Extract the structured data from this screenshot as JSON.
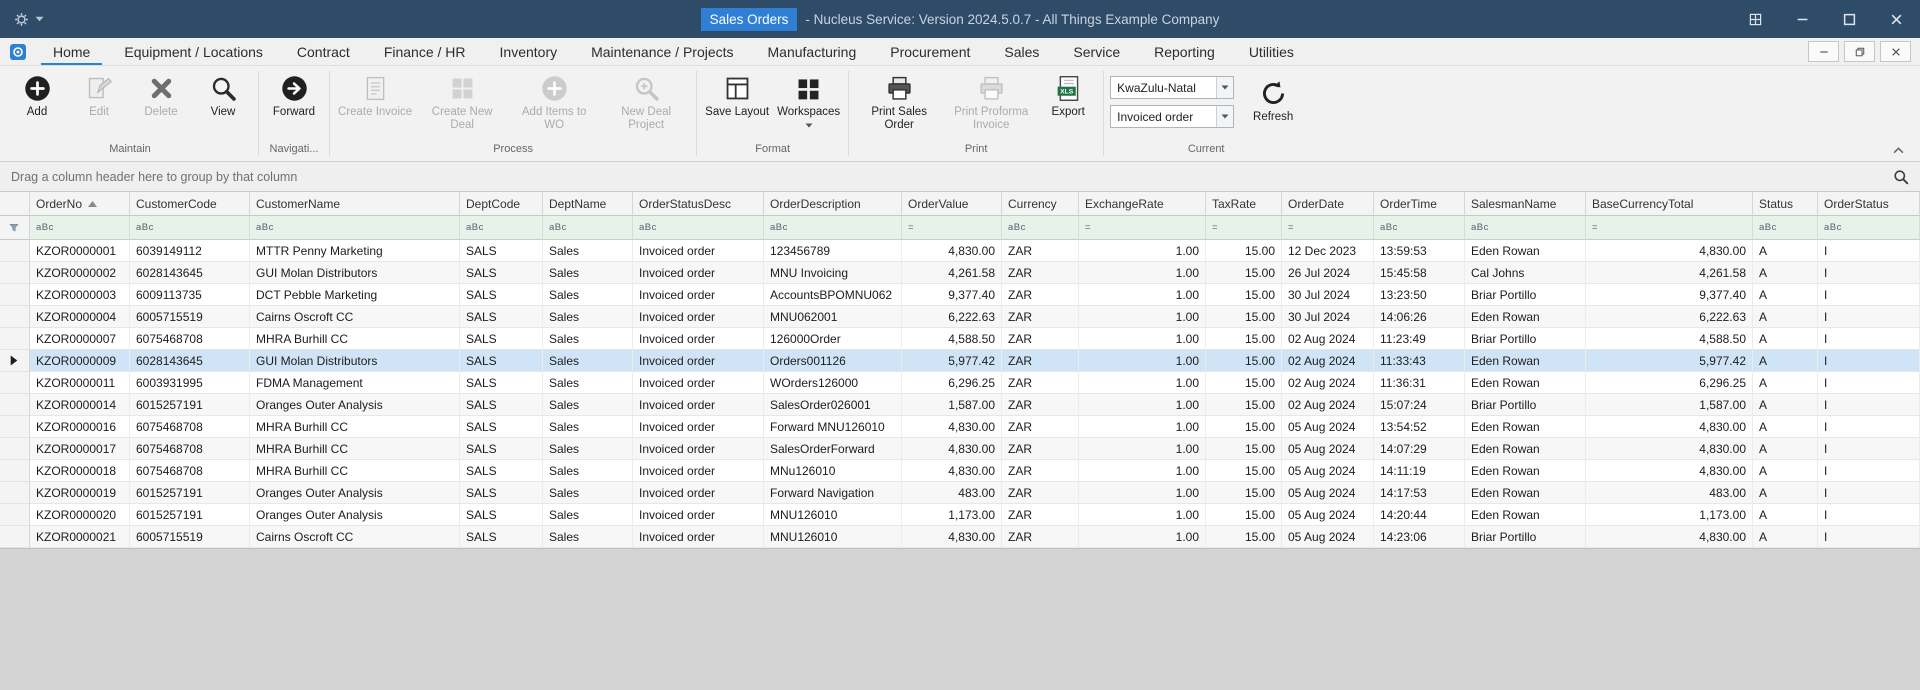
{
  "colors": {
    "accent_blue": "#2f80d4",
    "titlebar_bg": "#2e4b68",
    "filter_row_bg": "#e6f2ea",
    "selected_row_bg": "#cfe5f7",
    "alt_row_bg": "#f7f7f7",
    "disabled_text": "#ababab",
    "xls_green": "#217346"
  },
  "icons": {
    "filter_text_glyph": "aBc",
    "filter_numeric_glyph": "="
  },
  "titlebar": {
    "title_highlight": "Sales Orders",
    "title_rest": "- Nucleus Service: Version 2024.5.0.7 - All Things Example Company",
    "left_icons": [
      "gear-icon",
      "caret-down-icon"
    ],
    "window_buttons": [
      "window-panels-icon",
      "minimize-icon",
      "maximize-icon",
      "close-icon"
    ]
  },
  "ribbon_tabs": [
    {
      "label": "Home",
      "active": true
    },
    {
      "label": "Equipment / Locations"
    },
    {
      "label": "Contract"
    },
    {
      "label": "Finance / HR"
    },
    {
      "label": "Inventory"
    },
    {
      "label": "Maintenance / Projects"
    },
    {
      "label": "Manufacturing"
    },
    {
      "label": "Procurement"
    },
    {
      "label": "Sales"
    },
    {
      "label": "Service"
    },
    {
      "label": "Reporting"
    },
    {
      "label": "Utilities"
    }
  ],
  "tab_window_buttons": [
    "minimize-icon",
    "restore-icon",
    "close-icon"
  ],
  "ribbon": {
    "groups": [
      {
        "label": "Maintain",
        "buttons": [
          {
            "label": "Add",
            "icon": "add-circle-icon",
            "enabled": true
          },
          {
            "label": "Edit",
            "icon": "edit-icon",
            "enabled": false
          },
          {
            "label": "Delete",
            "icon": "delete-x-icon",
            "enabled": false
          },
          {
            "label": "View",
            "icon": "view-magnifier-icon",
            "enabled": true
          }
        ]
      },
      {
        "label": "Navigati...",
        "buttons": [
          {
            "label": "Forward",
            "icon": "forward-circle-icon",
            "enabled": true
          }
        ]
      },
      {
        "label": "Process",
        "buttons": [
          {
            "label": "Create Invoice",
            "icon": "create-invoice-icon",
            "enabled": false
          },
          {
            "label": "Create New Deal",
            "icon": "create-new-deal-icon",
            "enabled": false
          },
          {
            "label": "Add Items to WO",
            "icon": "add-items-icon",
            "enabled": false
          },
          {
            "label": "New Deal Project",
            "icon": "new-deal-project-icon",
            "enabled": false
          }
        ]
      },
      {
        "label": "Format",
        "buttons": [
          {
            "label": "Save Layout",
            "icon": "save-layout-icon",
            "enabled": true
          },
          {
            "label": "Workspaces",
            "icon": "workspaces-icon",
            "enabled": true,
            "dropdown": true
          }
        ]
      },
      {
        "label": "Print",
        "buttons": [
          {
            "label": "Print Sales Order",
            "icon": "print-icon",
            "enabled": true
          },
          {
            "label": "Print Proforma Invoice",
            "icon": "print-proforma-icon",
            "enabled": false
          },
          {
            "label": "Export",
            "icon": "export-xls-icon",
            "enabled": true
          }
        ]
      },
      {
        "label": "Current",
        "controls": {
          "region_dropdown": "KwaZulu-Natal",
          "order_type_dropdown": "Invoiced order",
          "refresh": {
            "label": "Refresh",
            "icon": "refresh-icon"
          }
        }
      }
    ]
  },
  "grid": {
    "groupby_text": "Drag a column header here to group by that column",
    "columns": [
      {
        "name": "OrderNo",
        "filter": "abc",
        "sort": "asc"
      },
      {
        "name": "CustomerCode",
        "filter": "abc"
      },
      {
        "name": "CustomerName",
        "filter": "abc"
      },
      {
        "name": "DeptCode",
        "filter": "abc"
      },
      {
        "name": "DeptName",
        "filter": "abc"
      },
      {
        "name": "OrderStatusDesc",
        "filter": "abc"
      },
      {
        "name": "OrderDescription",
        "filter": "abc"
      },
      {
        "name": "OrderValue",
        "filter": "eq",
        "align": "right"
      },
      {
        "name": "Currency",
        "filter": "abc"
      },
      {
        "name": "ExchangeRate",
        "filter": "eq",
        "align": "right"
      },
      {
        "name": "TaxRate",
        "filter": "eq",
        "align": "right"
      },
      {
        "name": "OrderDate",
        "filter": "eq"
      },
      {
        "name": "OrderTime",
        "filter": "abc"
      },
      {
        "name": "SalesmanName",
        "filter": "abc"
      },
      {
        "name": "BaseCurrencyTotal",
        "filter": "eq",
        "align": "right"
      },
      {
        "name": "Status",
        "filter": "abc"
      },
      {
        "name": "OrderStatus",
        "filter": "abc"
      }
    ],
    "selected_order_no": "KZOR0000009",
    "rows": [
      [
        "KZOR0000001",
        "6039149112",
        "MTTR Penny Marketing",
        "SALS",
        "Sales",
        "Invoiced order",
        "123456789",
        "4,830.00",
        "ZAR",
        "1.00",
        "15.00",
        "12 Dec 2023",
        "13:59:53",
        "Eden Rowan",
        "4,830.00",
        "A",
        "I"
      ],
      [
        "KZOR0000002",
        "6028143645",
        "GUI Molan Distributors",
        "SALS",
        "Sales",
        "Invoiced order",
        "MNU Invoicing",
        "4,261.58",
        "ZAR",
        "1.00",
        "15.00",
        "26 Jul 2024",
        "15:45:58",
        "Cal Johns",
        "4,261.58",
        "A",
        "I"
      ],
      [
        "KZOR0000003",
        "6009113735",
        "DCT Pebble Marketing",
        "SALS",
        "Sales",
        "Invoiced order",
        "AccountsBPOMNU062",
        "9,377.40",
        "ZAR",
        "1.00",
        "15.00",
        "30 Jul 2024",
        "13:23:50",
        "Briar Portillo",
        "9,377.40",
        "A",
        "I"
      ],
      [
        "KZOR0000004",
        "6005715519",
        "Cairns Oscroft CC",
        "SALS",
        "Sales",
        "Invoiced order",
        "MNU062001",
        "6,222.63",
        "ZAR",
        "1.00",
        "15.00",
        "30 Jul 2024",
        "14:06:26",
        "Eden Rowan",
        "6,222.63",
        "A",
        "I"
      ],
      [
        "KZOR0000007",
        "6075468708",
        "MHRA Burhill CC",
        "SALS",
        "Sales",
        "Invoiced order",
        "126000Order",
        "4,588.50",
        "ZAR",
        "1.00",
        "15.00",
        "02 Aug 2024",
        "11:23:49",
        "Briar Portillo",
        "4,588.50",
        "A",
        "I"
      ],
      [
        "KZOR0000009",
        "6028143645",
        "GUI Molan Distributors",
        "SALS",
        "Sales",
        "Invoiced order",
        "Orders001126",
        "5,977.42",
        "ZAR",
        "1.00",
        "15.00",
        "02 Aug 2024",
        "11:33:43",
        "Eden Rowan",
        "5,977.42",
        "A",
        "I"
      ],
      [
        "KZOR0000011",
        "6003931995",
        "FDMA Management",
        "SALS",
        "Sales",
        "Invoiced order",
        "WOrders126000",
        "6,296.25",
        "ZAR",
        "1.00",
        "15.00",
        "02 Aug 2024",
        "11:36:31",
        "Eden Rowan",
        "6,296.25",
        "A",
        "I"
      ],
      [
        "KZOR0000014",
        "6015257191",
        "Oranges Outer Analysis",
        "SALS",
        "Sales",
        "Invoiced order",
        "SalesOrder026001",
        "1,587.00",
        "ZAR",
        "1.00",
        "15.00",
        "02 Aug 2024",
        "15:07:24",
        "Briar Portillo",
        "1,587.00",
        "A",
        "I"
      ],
      [
        "KZOR0000016",
        "6075468708",
        "MHRA Burhill CC",
        "SALS",
        "Sales",
        "Invoiced order",
        "Forward MNU126010",
        "4,830.00",
        "ZAR",
        "1.00",
        "15.00",
        "05 Aug 2024",
        "13:54:52",
        "Eden Rowan",
        "4,830.00",
        "A",
        "I"
      ],
      [
        "KZOR0000017",
        "6075468708",
        "MHRA Burhill CC",
        "SALS",
        "Sales",
        "Invoiced order",
        "SalesOrderForward",
        "4,830.00",
        "ZAR",
        "1.00",
        "15.00",
        "05 Aug 2024",
        "14:07:29",
        "Eden Rowan",
        "4,830.00",
        "A",
        "I"
      ],
      [
        "KZOR0000018",
        "6075468708",
        "MHRA Burhill CC",
        "SALS",
        "Sales",
        "Invoiced order",
        "MNu126010",
        "4,830.00",
        "ZAR",
        "1.00",
        "15.00",
        "05 Aug 2024",
        "14:11:19",
        "Eden Rowan",
        "4,830.00",
        "A",
        "I"
      ],
      [
        "KZOR0000019",
        "6015257191",
        "Oranges Outer Analysis",
        "SALS",
        "Sales",
        "Invoiced order",
        "Forward Navigation",
        "483.00",
        "ZAR",
        "1.00",
        "15.00",
        "05 Aug 2024",
        "14:17:53",
        "Eden Rowan",
        "483.00",
        "A",
        "I"
      ],
      [
        "KZOR0000020",
        "6015257191",
        "Oranges Outer Analysis",
        "SALS",
        "Sales",
        "Invoiced order",
        "MNU126010",
        "1,173.00",
        "ZAR",
        "1.00",
        "15.00",
        "05 Aug 2024",
        "14:20:44",
        "Eden Rowan",
        "1,173.00",
        "A",
        "I"
      ],
      [
        "KZOR0000021",
        "6005715519",
        "Cairns Oscroft CC",
        "SALS",
        "Sales",
        "Invoiced order",
        "MNU126010",
        "4,830.00",
        "ZAR",
        "1.00",
        "15.00",
        "05 Aug 2024",
        "14:23:06",
        "Briar Portillo",
        "4,830.00",
        "A",
        "I"
      ]
    ]
  }
}
